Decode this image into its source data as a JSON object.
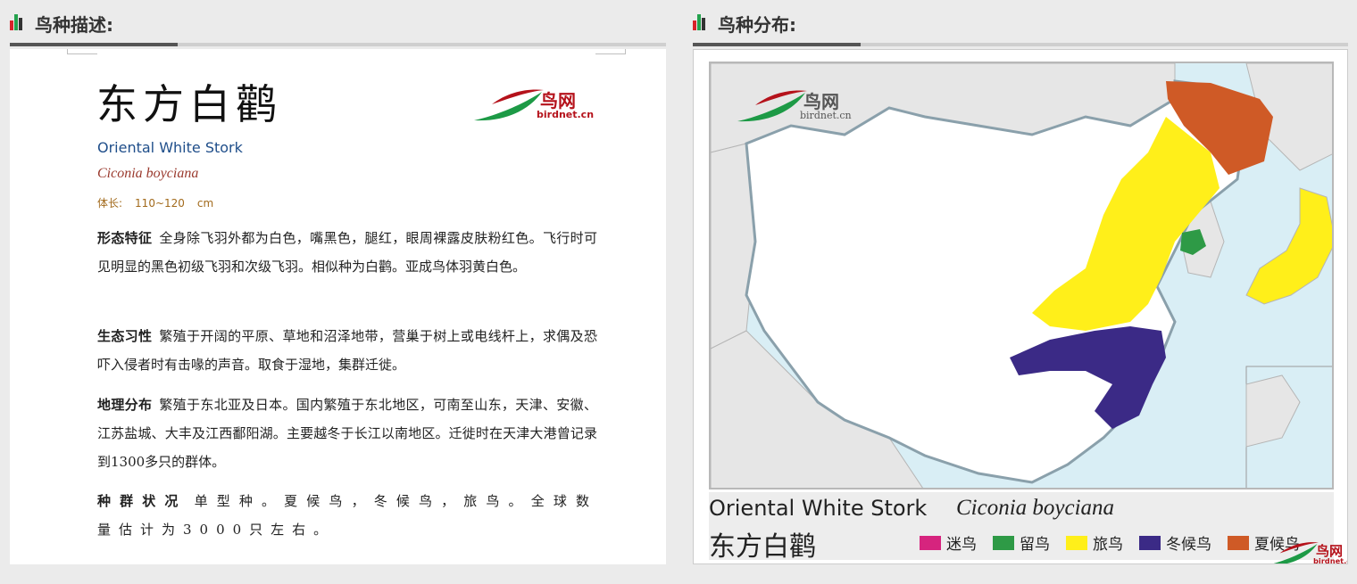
{
  "headers": {
    "description": "鸟种描述:",
    "distribution": "鸟种分布:"
  },
  "logo": {
    "cn": "鸟网",
    "en": "birdnet.cn"
  },
  "bird": {
    "name_cn": "东方白鹳",
    "name_en": "Oriental White Stork",
    "name_sci": "Ciconia boyciana",
    "size_label": "体长:",
    "size_value": "110~120",
    "size_unit": "cm"
  },
  "sections": [
    {
      "label": "形态特征",
      "text": "全身除飞羽外都为白色，嘴黑色，腿红，眼周裸露皮肤粉红色。飞行时可见明显的黑色初级飞羽和次级飞羽。相似种为白鹳。亚成鸟体羽黄白色。"
    },
    {
      "label": "生态习性",
      "text": "繁殖于开阔的平原、草地和沼泽地带，营巢于树上或电线杆上，求偶及恐吓入侵者时有击喙的声音。取食于湿地，集群迁徙。"
    },
    {
      "label": "地理分布",
      "text": "繁殖于东北亚及日本。国内繁殖于东北地区，可南至山东，天津、安徽、江苏盐城、大丰及江西鄱阳湖。主要越冬于长江以南地区。迁徙时在天津大港曾记录到1300多只的群体。"
    },
    {
      "label": "种群状况",
      "text": "单型种。夏候鸟，冬候鸟，旅鸟。全球数量估计为3000只左右。"
    }
  ],
  "map": {
    "title_en": "Oriental White Stork",
    "title_sci": "Ciconia boyciana",
    "title_cn": "东方白鹳",
    "colors": {
      "sea": "#d9eef5",
      "land": "#ffffff",
      "outside_land": "#e6e6e6",
      "border": "#8aa0ab"
    },
    "legend": [
      {
        "label": "迷鸟",
        "color": "#d6247e"
      },
      {
        "label": "留鸟",
        "color": "#2e9a46"
      },
      {
        "label": "旅鸟",
        "color": "#ffef1a"
      },
      {
        "label": "冬候鸟",
        "color": "#3b2a86"
      },
      {
        "label": "夏候鸟",
        "color": "#cf5a26"
      }
    ]
  }
}
